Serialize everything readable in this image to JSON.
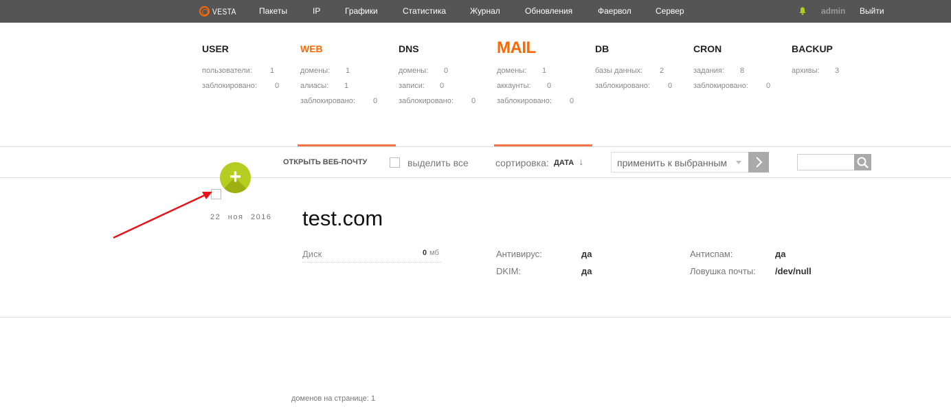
{
  "topbar": {
    "logo": "VESTA",
    "nav": [
      "Пакеты",
      "IP",
      "Графики",
      "Статистика",
      "Журнал",
      "Обновления",
      "Фаервол",
      "Сервер"
    ],
    "user": "admin",
    "logout": "Выйти"
  },
  "menu": {
    "user": {
      "title": "USER",
      "stats": [
        {
          "label": "пользователи:",
          "value": "1"
        },
        {
          "label": "заблокировано:",
          "value": "0"
        }
      ]
    },
    "web": {
      "title": "WEB",
      "stats": [
        {
          "label": "домены:",
          "value": "1"
        },
        {
          "label": "алиасы:",
          "value": "1"
        },
        {
          "label": "заблокировано:",
          "value": "0"
        }
      ]
    },
    "dns": {
      "title": "DNS",
      "stats": [
        {
          "label": "домены:",
          "value": "0"
        },
        {
          "label": "записи:",
          "value": "0"
        },
        {
          "label": "заблокировано:",
          "value": "0"
        }
      ]
    },
    "mail": {
      "title": "MAIL",
      "stats": [
        {
          "label": "домены:",
          "value": "1"
        },
        {
          "label": "аккаунты:",
          "value": "0"
        },
        {
          "label": "заблокировано:",
          "value": "0"
        }
      ]
    },
    "db": {
      "title": "DB",
      "stats": [
        {
          "label": "базы данных:",
          "value": "2"
        },
        {
          "label": "заблокировано:",
          "value": "0"
        }
      ]
    },
    "cron": {
      "title": "CRON",
      "stats": [
        {
          "label": "задания:",
          "value": "8"
        },
        {
          "label": "заблокировано:",
          "value": "0"
        }
      ]
    },
    "backup": {
      "title": "BACKUP",
      "stats": [
        {
          "label": "архивы:",
          "value": "3"
        }
      ]
    }
  },
  "toolbar": {
    "webmail": "ОТКРЫТЬ ВЕБ-ПОЧТУ",
    "select_all": "выделить все",
    "sort_label": "сортировка:",
    "sort_value": "ДАТА",
    "sort_arrow": "↓",
    "apply": "применить к выбранным",
    "search_placeholder": ""
  },
  "add_button": "+",
  "domain_row": {
    "date": "22 ноя 2016",
    "domain": "test.com",
    "disk_label": "Диск",
    "disk_value": "0",
    "disk_unit": "мб",
    "antivirus_label": "Антивирус:",
    "antivirus_value": "да",
    "dkim_label": "DKIM:",
    "dkim_value": "да",
    "antispam_label": "Антиспам:",
    "antispam_value": "да",
    "catchall_label": "Ловушка почты:",
    "catchall_value": "/dev/null"
  },
  "footer": "доменов на странице: 1",
  "colors": {
    "accent": "#ff6701",
    "add_button": "#b5cc21",
    "topbar": "#555555",
    "annotation_arrow": "#e8121a"
  }
}
